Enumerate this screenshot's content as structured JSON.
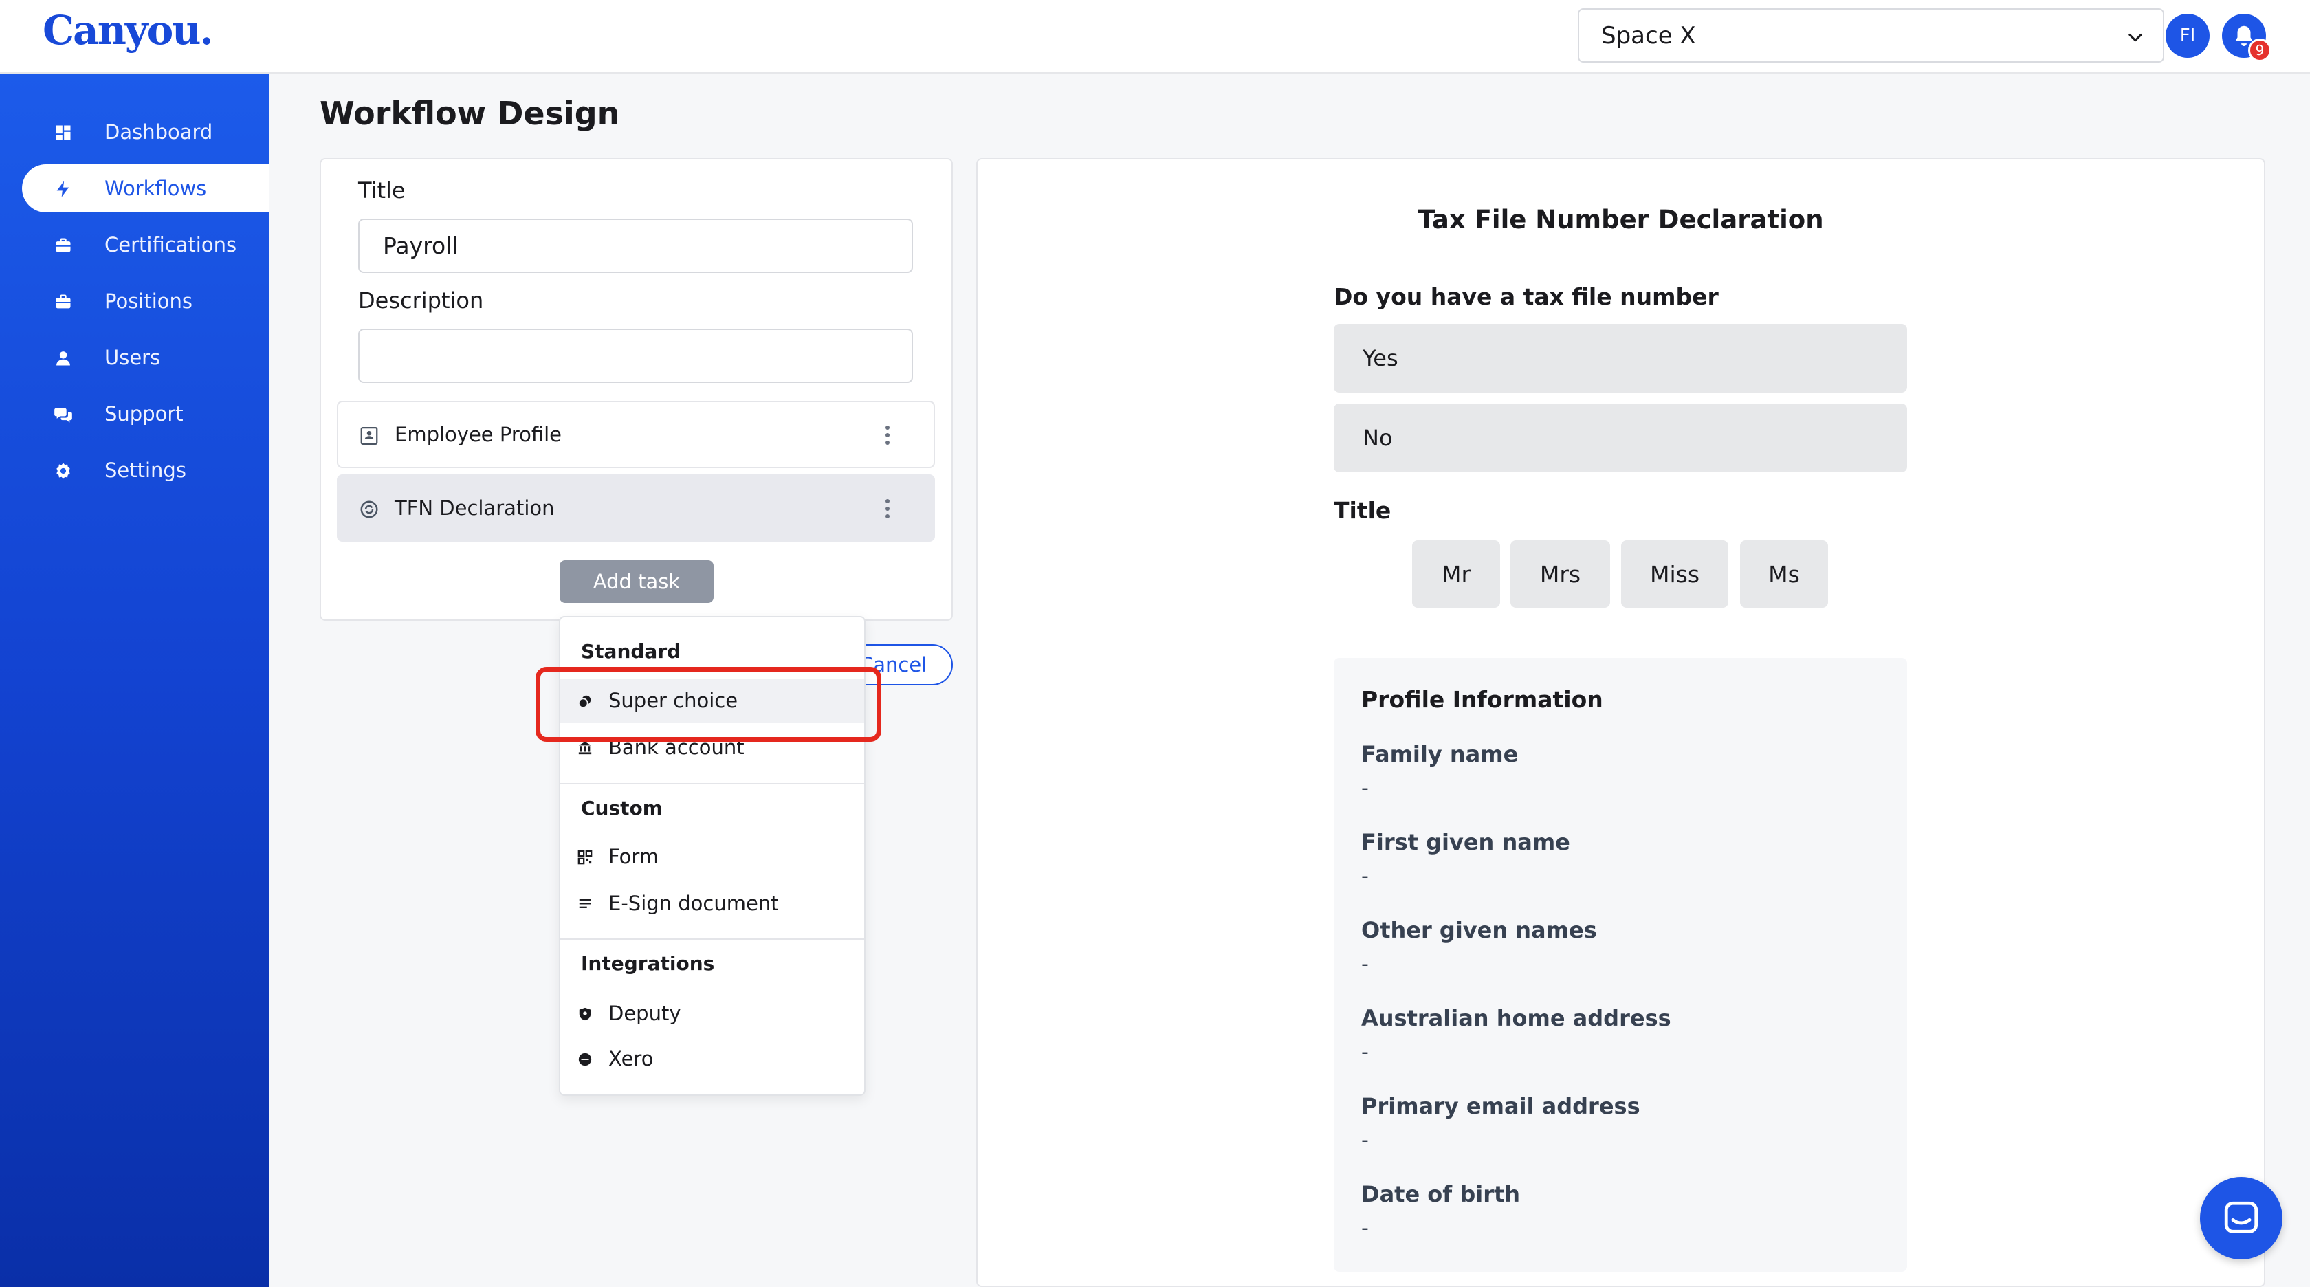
{
  "app": {
    "logo": "Canyou."
  },
  "header": {
    "space_select": "Space X",
    "avatar_initials": "FI",
    "notification_count": "9"
  },
  "sidebar": {
    "items": [
      {
        "label": "Dashboard",
        "icon": "grid-icon"
      },
      {
        "label": "Workflows",
        "icon": "lightning-icon",
        "active": true
      },
      {
        "label": "Certifications",
        "icon": "briefcase-icon"
      },
      {
        "label": "Positions",
        "icon": "briefcase-icon"
      },
      {
        "label": "Users",
        "icon": "user-icon"
      },
      {
        "label": "Support",
        "icon": "chat-bubbles-icon"
      },
      {
        "label": "Settings",
        "icon": "gear-icon"
      }
    ]
  },
  "page": {
    "title": "Workflow Design"
  },
  "form": {
    "title_label": "Title",
    "title_value": "Payroll",
    "description_label": "Description",
    "description_value": "",
    "tasks": [
      {
        "label": "Employee Profile",
        "icon": "profile-card-icon"
      },
      {
        "label": "TFN Declaration",
        "icon": "tfn-icon",
        "selected": true
      }
    ],
    "add_task_label": "Add task",
    "cancel_label": "Cancel"
  },
  "dropdown": {
    "sections": [
      {
        "heading": "Standard",
        "items": [
          {
            "label": "Super choice",
            "icon": "coins-icon",
            "highlighted": true
          },
          {
            "label": "Bank account",
            "icon": "bank-icon"
          }
        ]
      },
      {
        "heading": "Custom",
        "items": [
          {
            "label": "Form",
            "icon": "qr-form-icon"
          },
          {
            "label": "E-Sign document",
            "icon": "document-lines-icon"
          }
        ]
      },
      {
        "heading": "Integrations",
        "items": [
          {
            "label": "Deputy",
            "icon": "shield-icon"
          },
          {
            "label": "Xero",
            "icon": "xero-icon"
          }
        ]
      }
    ]
  },
  "preview": {
    "title": "Tax File Number Declaration",
    "question1": "Do you have a tax file number",
    "options": [
      "Yes",
      "No"
    ],
    "title_question": "Title",
    "title_options": [
      "Mr",
      "Mrs",
      "Miss",
      "Ms"
    ],
    "profile": {
      "heading": "Profile Information",
      "fields": [
        {
          "label": "Family name",
          "value": "-"
        },
        {
          "label": "First given name",
          "value": "-"
        },
        {
          "label": "Other given names",
          "value": "-"
        },
        {
          "label": "Australian home address",
          "value": "-"
        },
        {
          "label": "Primary email address",
          "value": "-"
        },
        {
          "label": "Date of birth",
          "value": "-"
        }
      ]
    }
  },
  "colors": {
    "brand": "#1e55e6",
    "highlight": "#e5281e",
    "sidebar": "#1c5bea"
  }
}
